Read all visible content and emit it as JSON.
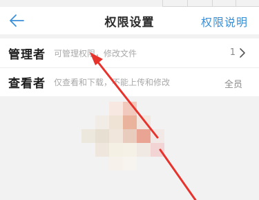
{
  "navbar": {
    "back_icon": "back-arrow-icon",
    "title": "权限设置",
    "right_link": "权限说明"
  },
  "rows": [
    {
      "title": "管理者",
      "description": "可管理权限，修改文件",
      "value": "1",
      "icon": "chevron-right-icon"
    },
    {
      "title": "查看者",
      "description": "仅查看和下载，不能上传和修改",
      "value": "全员"
    }
  ],
  "colors": {
    "accent": "#3a8fd9",
    "annotation": "#e8322c",
    "background": "#f2f2f2"
  }
}
